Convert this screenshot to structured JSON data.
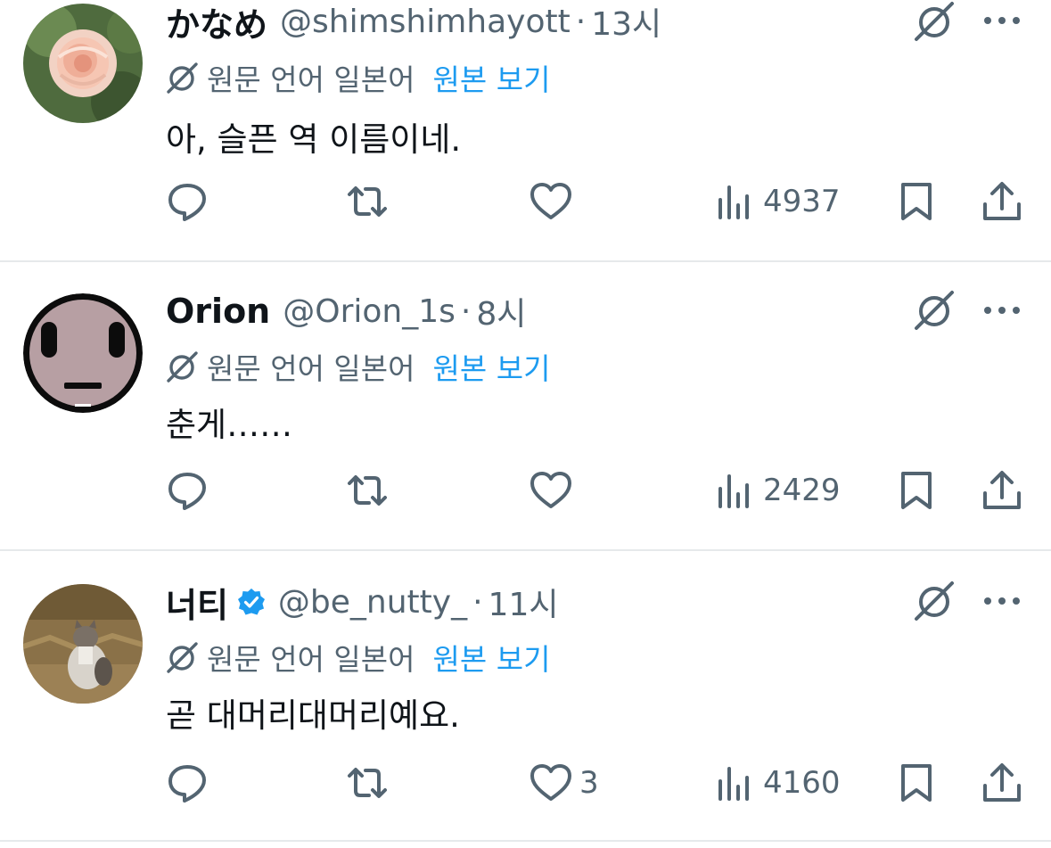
{
  "tweets": [
    {
      "display_name": "かなめ",
      "handle": "@shimshimhayott",
      "separator": "·",
      "time": "13시",
      "translation_note": "원문 언어 일본어",
      "view_original": "원본 보기",
      "text": "아, 슬픈 역 이름이네.",
      "likes": "",
      "views": "4937",
      "avatar": "rose-photo",
      "verified": false
    },
    {
      "display_name": "Orion",
      "handle": "@Orion_1s",
      "separator": "·",
      "time": "8시",
      "translation_note": "원문 언어 일본어",
      "view_original": "원본 보기",
      "text": "춘게……",
      "likes": "",
      "views": "2429",
      "avatar": "face-icon",
      "verified": false
    },
    {
      "display_name": "너티",
      "handle": "@be_nutty_",
      "separator": "·",
      "time": "11시",
      "translation_note": "원문 언어 일본어",
      "view_original": "원본 보기",
      "text": "곧 대머리대머리예요.",
      "likes": "3",
      "views": "4160",
      "avatar": "cat-photo",
      "verified": true
    }
  ],
  "colors": {
    "text": "#0f1419",
    "secondary": "#536471",
    "link": "#1d9bf0",
    "divider": "#e6e9eb"
  }
}
